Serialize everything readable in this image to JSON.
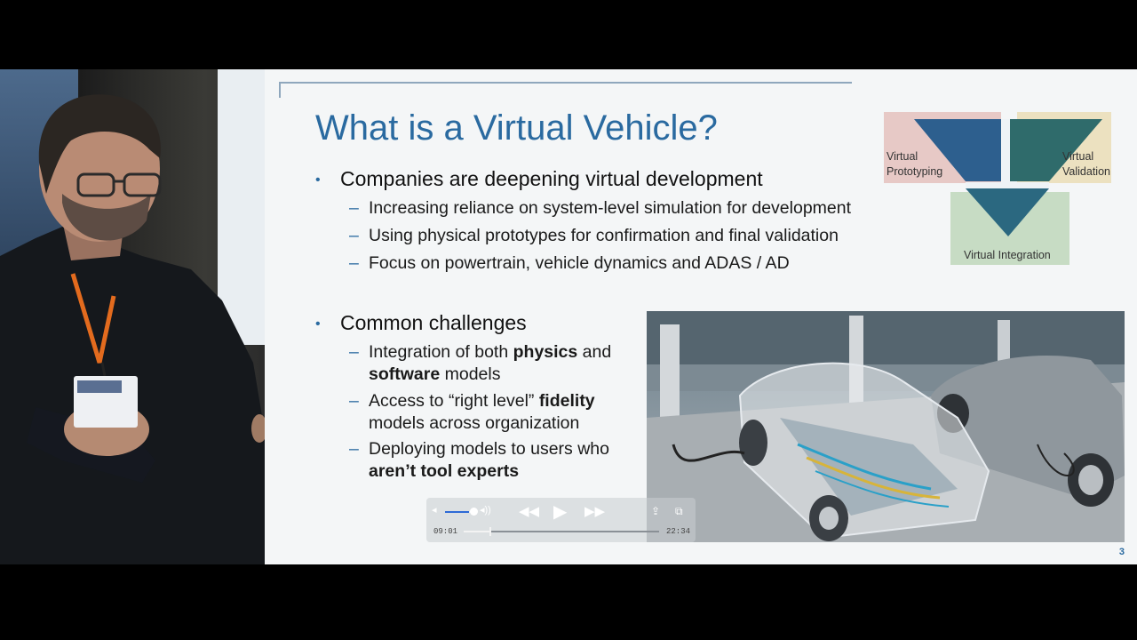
{
  "slide": {
    "title": "What is a Virtual Vehicle?",
    "section1": {
      "heading": "Companies are deepening virtual development",
      "items": [
        "Increasing reliance on system-level simulation for development",
        "Using physical prototypes for confirmation and final validation",
        "Focus on powertrain, vehicle dynamics and ADAS / AD"
      ]
    },
    "section2": {
      "heading": "Common challenges",
      "items": [
        {
          "line1_a": "Integration of both ",
          "line1_b": "physics",
          "line1_c": " and",
          "line2_b": "software",
          "line2_c": " models"
        },
        {
          "line1_a": "Access to “right level” ",
          "line1_b": "fidelity",
          "line2_c": "models across organization"
        },
        {
          "line1_a": "Deploying models to users who",
          "line2_b": "aren’t tool experts"
        }
      ]
    },
    "diagram": {
      "left_label": [
        "Virtual",
        "Prototyping"
      ],
      "right_label": [
        "Virtual",
        "Validation"
      ],
      "bottom_label": "Virtual Integration",
      "colors": {
        "left": "#e7c9c6",
        "right": "#ece1c0",
        "bottom": "#c7dcc4",
        "tri_left": "#2d5f8e",
        "tri_right": "#2f6b6b",
        "tri_bottom": "#2b6880"
      }
    },
    "page_number": "3"
  },
  "player": {
    "current_time": "09:01",
    "total_time": "22:34",
    "progress_fraction": 0.02,
    "volume_fraction": 0.8,
    "icons": [
      "volume-low-icon",
      "volume-high-icon",
      "rewind-icon",
      "play-icon",
      "fast-forward-icon",
      "share-icon",
      "pip-icon"
    ]
  },
  "colors": {
    "title": "#2a6aa0",
    "accent": "#2a6aa0",
    "slide_bg": "#f4f6f7"
  }
}
